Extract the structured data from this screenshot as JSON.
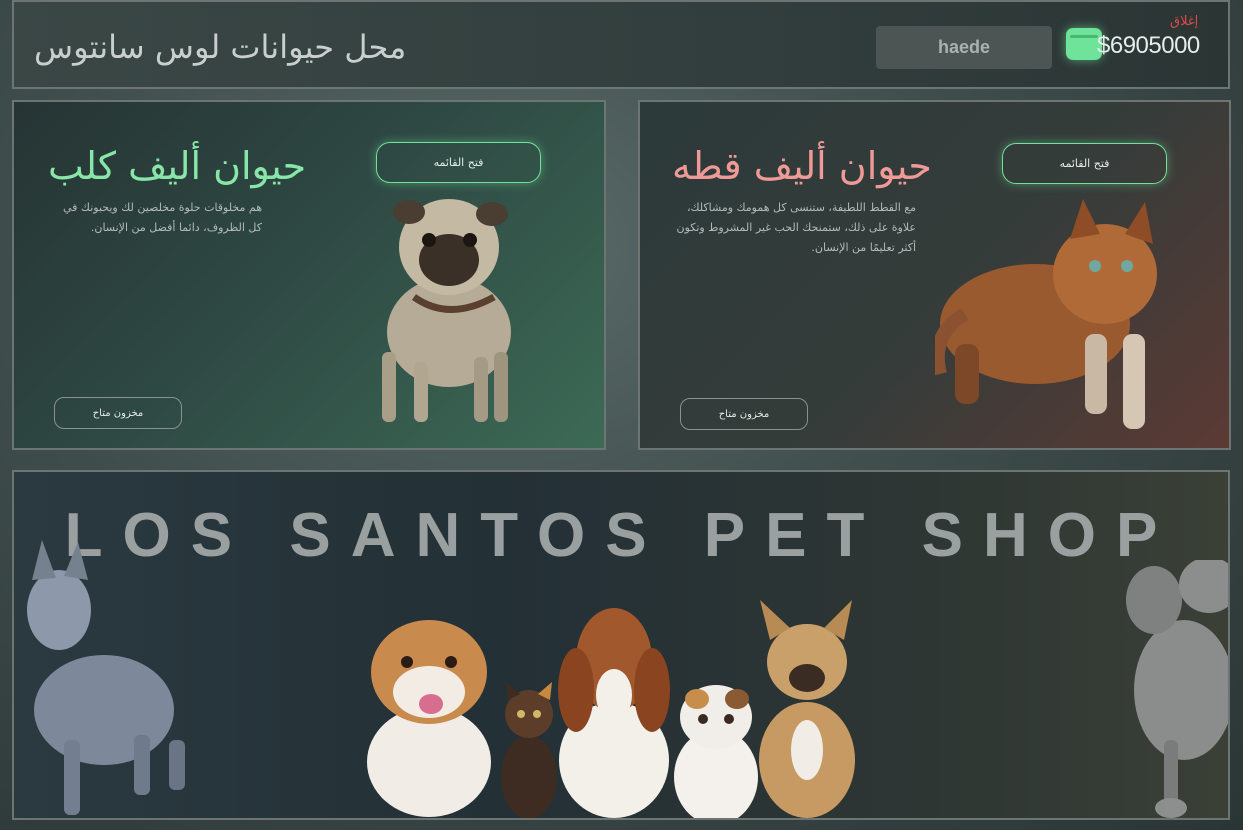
{
  "header": {
    "shop_title": "محل حيوانات لوس سانتوس",
    "username": "haede",
    "money": "$6905000",
    "close_label": "إغلاق",
    "wallet_icon": "wallet-icon"
  },
  "dog_card": {
    "title": "حيوان أليف كلب",
    "description": "هم مخلوقات حلوة مخلصين لك ويحبونك في كل الظروف، دائما أفضل من الإنسان.",
    "open_label": "فتح القائمه",
    "stock_label": "مخزون متاح",
    "image": "pug-dog-image"
  },
  "cat_card": {
    "title": "حيوان أليف قطه",
    "description": "مع القطط اللطيفة، ستنسى كل همومك ومشاكلك، علاوة على ذلك، ستمنحك الحب غير المشروط وتكون أكثر تعليمًا من الإنسان.",
    "open_label": "فتح القائمه",
    "stock_label": "مخزون متاح",
    "image": "orange-cat-image"
  },
  "banner": {
    "title": "LOS SANTOS PET SHOP"
  },
  "colors": {
    "accent_green": "#6fe39a",
    "dog_title": "#88e6a8",
    "cat_title": "#ef9a96",
    "close_red": "#e0494a"
  }
}
